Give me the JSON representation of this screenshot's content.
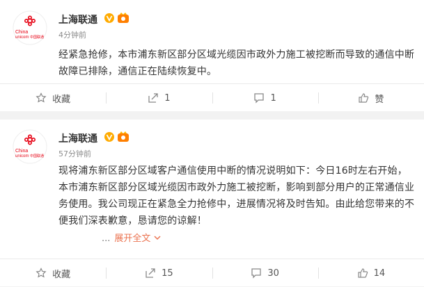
{
  "posts": [
    {
      "author": "上海联通",
      "time": "4分钟前",
      "text": "经紧急抢修，本市浦东新区部分区域光缆因市政外力施工被挖断而导致的通信中断故障已排除，通信正在陆续恢复中。",
      "actions": {
        "collect": "收藏",
        "repost": "1",
        "comment": "1",
        "like": "赞"
      }
    },
    {
      "author": "上海联通",
      "time": "57分钟前",
      "text": "现将浦东新区部分区域客户通信使用中断的情况说明如下：今日16时左右开始，本市浦东新区部分区域光缆因市政外力施工被挖断，影响到部分用户的正常通信业务使用。我公司现正在紧急全力抢修中，进展情况将及时告知。由此给您带来的不便我们深表歉意，恳请您的谅解！",
      "more_dots": "...",
      "expand_label": "展开全文",
      "actions": {
        "collect": "收藏",
        "repost": "15",
        "comment": "30",
        "like": "14"
      }
    }
  ],
  "avatar_text": {
    "brand_en": "China",
    "brand_en2": "unicom",
    "brand_cn": "中国联通"
  },
  "colors": {
    "brand_red": "#e60012",
    "verified": "#ffab00",
    "link": "#eb7350",
    "muted": "#8c8c8c"
  }
}
